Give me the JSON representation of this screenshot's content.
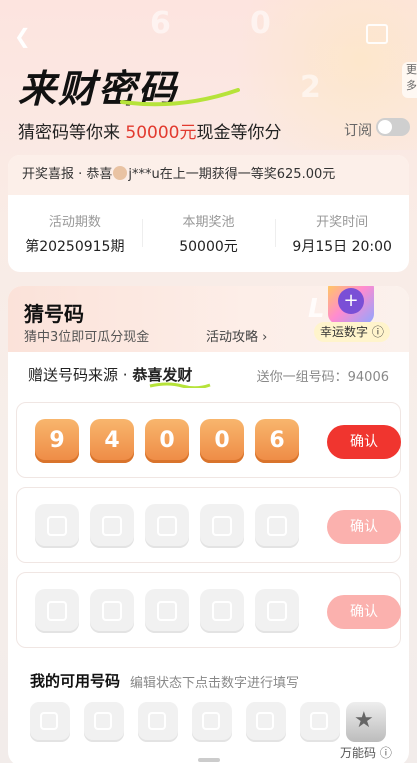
{
  "header": {
    "title": "来财密码",
    "subtitle_prefix": "猜密码等你来 ",
    "subtitle_amount": "50000元",
    "subtitle_suffix": "现金等你分",
    "subscribe_label": "订阅",
    "subscribe_on": false,
    "more_label": "更多",
    "back_icon": "chevron-left-icon",
    "share_icon": "share-icon"
  },
  "notice": {
    "prefix": "开奖喜报 · 恭喜",
    "user": "j***u",
    "suffix": "在上一期获得一等奖625.00元"
  },
  "stats": [
    {
      "label": "活动期数",
      "value": "第20250915期"
    },
    {
      "label": "本期奖池",
      "value": "50000元"
    },
    {
      "label": "开奖时间",
      "value": "9月15日 20:00"
    }
  ],
  "guess": {
    "title": "猜号码",
    "subtitle": "猜中3位即可瓜分现金",
    "strategy": "活动攻略 ›",
    "lucky_label": "幸运数字 ⓘ",
    "lucky_icon": "plus-icon",
    "source_label_prefix": "赠送号码来源 · ",
    "source_label_highlight": "恭喜发财",
    "source_number_text": "送你一组号码：94006"
  },
  "rows": [
    {
      "digits": [
        "9",
        "4",
        "0",
        "0",
        "6"
      ],
      "confirm": "确认",
      "state": "active"
    },
    {
      "digits": [
        "",
        "",
        "",
        "",
        ""
      ],
      "confirm": "确认",
      "state": "disabled"
    },
    {
      "digits": [
        "",
        "",
        "",
        "",
        ""
      ],
      "confirm": "确认",
      "state": "disabled"
    }
  ],
  "my_codes": {
    "title": "我的可用号码",
    "hint": "编辑状态下点击数字进行填写",
    "wild_label": "万能码 ⓘ",
    "wild_icon": "star-icon"
  },
  "colors": {
    "accent": "#f0352f",
    "ball": "#ee8a44",
    "disabled": "#fbb1ae"
  }
}
